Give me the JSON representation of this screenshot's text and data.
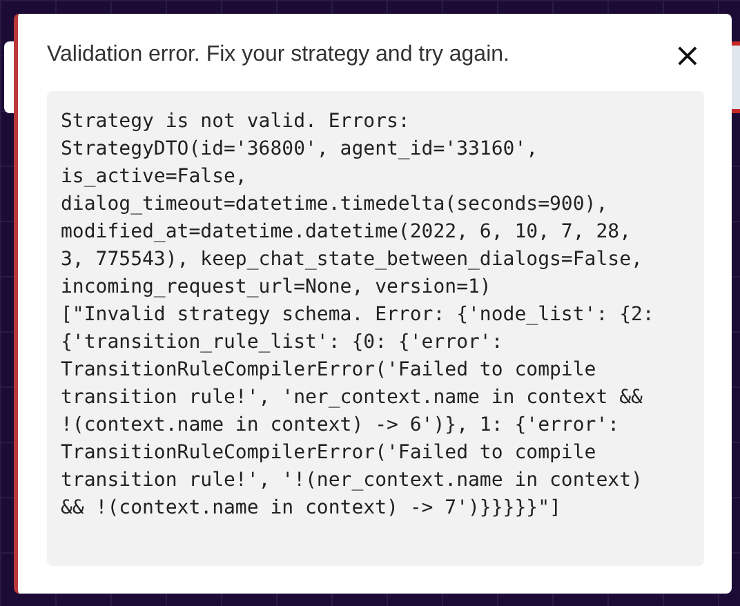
{
  "dialog": {
    "title": "Validation error. Fix your strategy and try again.",
    "close_label": "×",
    "message": "Strategy is not valid. Errors:\nStrategyDTO(id='36800', agent_id='33160',\nis_active=False,\ndialog_timeout=datetime.timedelta(seconds=900),\nmodified_at=datetime.datetime(2022, 6, 10, 7, 28,\n3, 775543), keep_chat_state_between_dialogs=False,\nincoming_request_url=None, version=1)\n[\"Invalid strategy schema. Error: {'node_list': {2:\n{'transition_rule_list': {0: {'error':\nTransitionRuleCompilerError('Failed to compile\ntransition rule!', 'ner_context.name in context &&\n!(context.name in context) -> 6')}, 1: {'error':\nTransitionRuleCompilerError('Failed to compile\ntransition rule!', '!(ner_context.name in context)\n&& !(context.name in context) -> 7')}}}}}\"]"
  }
}
